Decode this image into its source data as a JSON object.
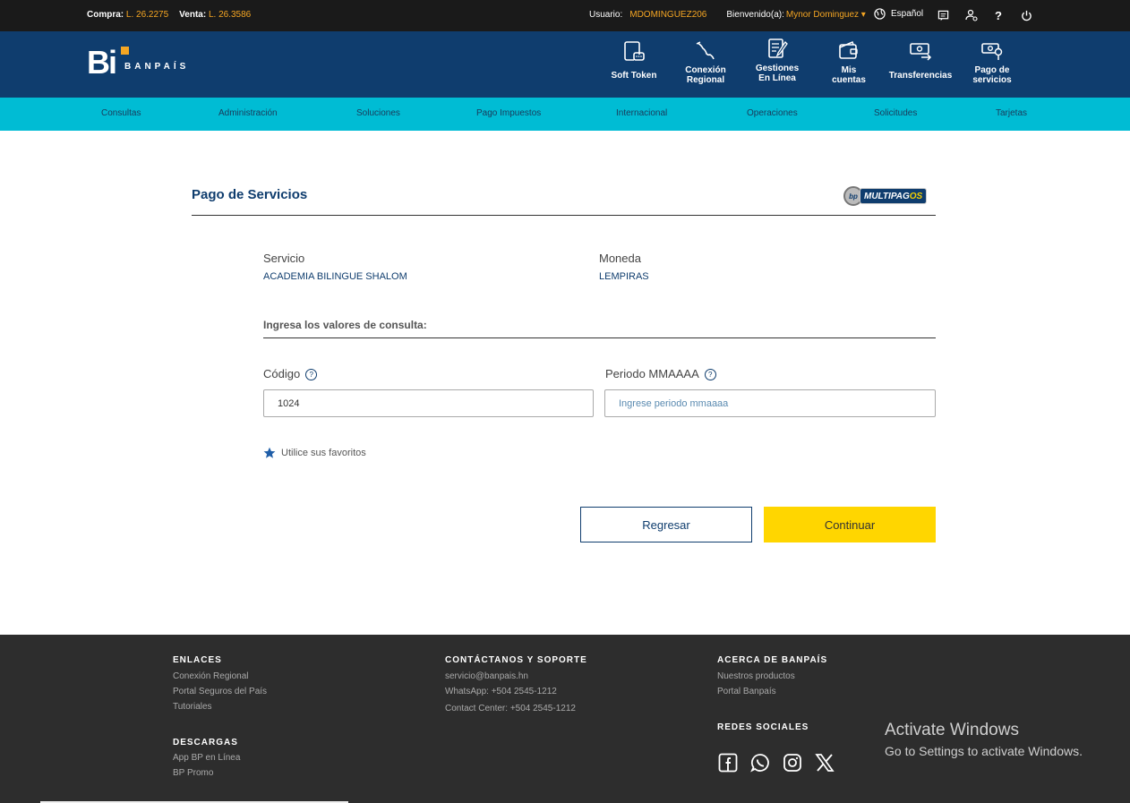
{
  "topbar": {
    "compra_label": "Compra:",
    "compra_value": "L. 26.2275",
    "venta_label": "Venta:",
    "venta_value": "L. 26.3586",
    "usuario_label": "Usuario:",
    "usuario_value": "MDOMINGUEZ206",
    "bienvenido_label": "Bienvenido(a):",
    "bienvenido_value": "Mynor Dominguez ▾",
    "language": "Español",
    "help": "?"
  },
  "header": {
    "logo_text": "Bi",
    "brand": "BANPAÍS",
    "nav": [
      {
        "line1": "Soft Token",
        "line2": "",
        "icon": "phone-token-icon"
      },
      {
        "line1": "Conexión",
        "line2": "Regional",
        "icon": "map-icon"
      },
      {
        "line1": "Gestiones",
        "line2": "En Línea",
        "icon": "document-edit-icon"
      },
      {
        "line1": "Mis",
        "line2": "cuentas",
        "icon": "wallet-icon"
      },
      {
        "line1": "Transferencias",
        "line2": "",
        "icon": "money-transfer-icon"
      },
      {
        "line1": "Pago de",
        "line2": "servicios",
        "icon": "bill-pay-icon"
      }
    ]
  },
  "menu": [
    "Consultas",
    "Administración",
    "Soluciones",
    "Pago Impuestos",
    "Internacional",
    "Operaciones",
    "Solicitudes",
    "Tarjetas"
  ],
  "main": {
    "title": "Pago de Servicios",
    "logo_circle": "bp",
    "logo_text_a": "MULTI",
    "logo_text_b": "PAG",
    "logo_text_c": "OS",
    "servicio_label": "Servicio",
    "servicio_value": "ACADEMIA BILINGUE SHALOM",
    "moneda_label": "Moneda",
    "moneda_value": "LEMPIRAS",
    "section_title": "Ingresa los valores de consulta:",
    "codigo_label": "Código",
    "codigo_value": "1024",
    "periodo_label": "Periodo MMAAAA",
    "periodo_placeholder": "Ingrese periodo mmaaaa",
    "favoritos": "Utilice sus favoritos",
    "btn_regresar": "Regresar",
    "btn_continuar": "Continuar"
  },
  "footer": {
    "enlaces_title": "ENLACES",
    "enlaces": [
      "Conexión Regional",
      "Portal Seguros del País",
      "Tutoriales"
    ],
    "descargas_title": "DESCARGAS",
    "descargas": [
      "App BP en Línea",
      "BP Promo"
    ],
    "contacto_title": "CONTÁCTANOS Y SOPORTE",
    "contacto": [
      "servicio@banpais.hn",
      "WhatsApp: +504 2545-1212",
      "Contact Center: +504 2545-1212"
    ],
    "acerca_title": "ACERCA DE BANPAÍS",
    "acerca": [
      "Nuestros productos",
      "Portal Banpaís"
    ],
    "redes_title": "REDES SOCIALES",
    "redes": [
      "facebook-icon",
      "whatsapp-icon",
      "instagram-icon",
      "x-icon"
    ]
  },
  "watermark": {
    "line1": "Activate Windows",
    "line2": "Go to Settings to activate Windows."
  }
}
